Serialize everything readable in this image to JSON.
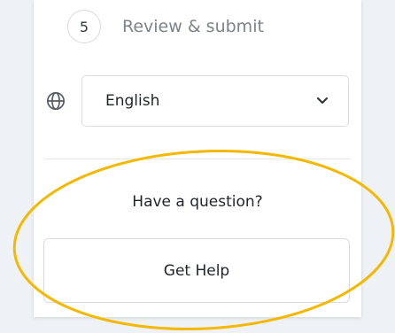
{
  "steps": {
    "step5": {
      "number": "5",
      "label": "Review & submit"
    }
  },
  "language": {
    "icon": "globe-icon",
    "selected": "English",
    "dropdown_icon": "chevron-down-icon"
  },
  "help": {
    "question": "Have a question?",
    "button_label": "Get Help"
  },
  "colors": {
    "annotation_outline": "#f5b800",
    "panel_background": "#ffffff",
    "page_background": "#eef1f5"
  }
}
